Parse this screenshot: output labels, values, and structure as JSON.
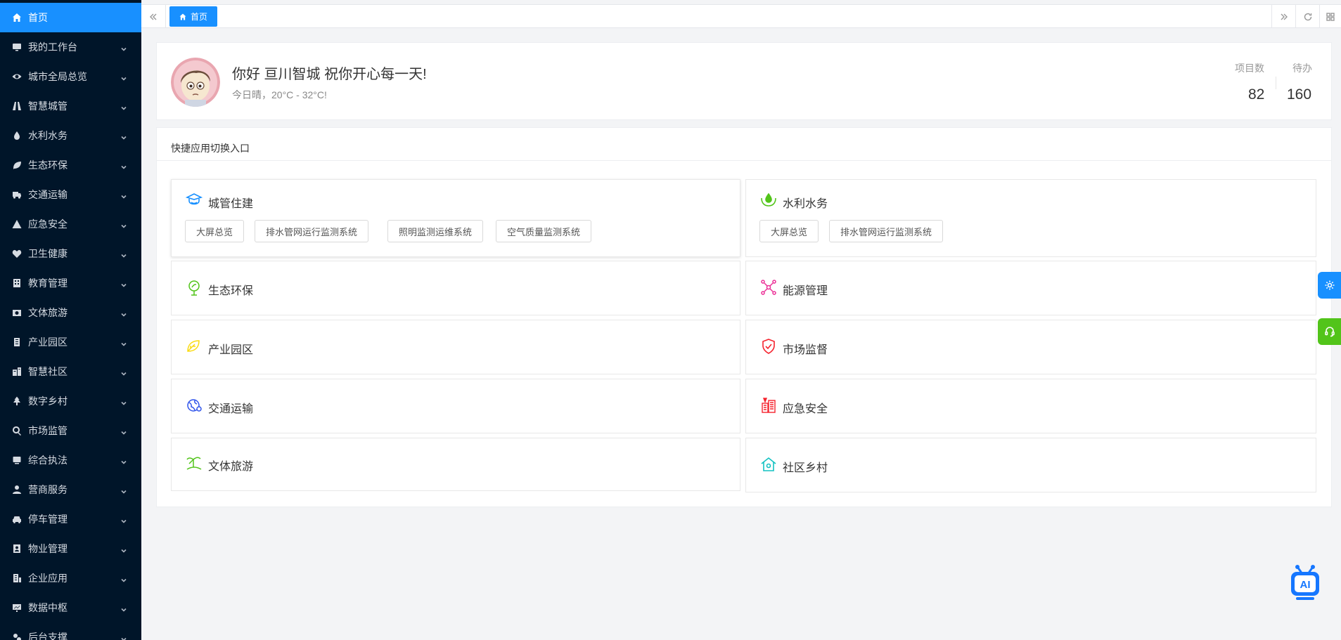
{
  "sidebar": {
    "items": [
      {
        "label": "首页",
        "icon": "home-icon",
        "active": true
      },
      {
        "label": "我的工作台",
        "icon": "monitor-icon"
      },
      {
        "label": "城市全局总览",
        "icon": "eye-icon"
      },
      {
        "label": "智慧城管",
        "icon": "road-icon"
      },
      {
        "label": "水利水务",
        "icon": "drop-icon"
      },
      {
        "label": "生态环保",
        "icon": "leaf-icon"
      },
      {
        "label": "交通运输",
        "icon": "truck-icon"
      },
      {
        "label": "应急安全",
        "icon": "warning-icon"
      },
      {
        "label": "卫生健康",
        "icon": "heartbeat-icon"
      },
      {
        "label": "教育管理",
        "icon": "school-icon"
      },
      {
        "label": "文体旅游",
        "icon": "camera-icon"
      },
      {
        "label": "产业园区",
        "icon": "building-icon"
      },
      {
        "label": "智慧社区",
        "icon": "community-icon"
      },
      {
        "label": "数字乡村",
        "icon": "tree-icon"
      },
      {
        "label": "市场监管",
        "icon": "search-icon"
      },
      {
        "label": "综合执法",
        "icon": "desktop-icon"
      },
      {
        "label": "营商服务",
        "icon": "user-icon"
      },
      {
        "label": "停车管理",
        "icon": "car-icon"
      },
      {
        "label": "物业管理",
        "icon": "contact-icon"
      },
      {
        "label": "企业应用",
        "icon": "office-icon"
      },
      {
        "label": "数据中枢",
        "icon": "presentation-icon"
      },
      {
        "label": "后台支撑",
        "icon": "cogs-icon"
      }
    ]
  },
  "tabs": {
    "items": [
      {
        "label": "首页",
        "icon": "home-icon"
      }
    ]
  },
  "welcome": {
    "greeting": "你好 亘川智城 祝你开心每一天!",
    "weather": "今日晴，20°C - 32°C!",
    "stats": [
      {
        "label": "项目数",
        "value": "82"
      },
      {
        "label": "待办",
        "value": "160"
      }
    ]
  },
  "quick": {
    "title": "快捷应用切换入口",
    "apps": [
      {
        "name": "城管住建",
        "icon": "police-cap-icon",
        "color": "#1890ff",
        "systems": [
          "大屏总览",
          "排水管网运行监测系统",
          "照明监测运维系统",
          "空气质量监测系统"
        ]
      },
      {
        "name": "水利水务",
        "icon": "water-hand-icon",
        "color": "#52c41a",
        "systems": [
          "大屏总览",
          "排水管网运行监测系统"
        ]
      },
      {
        "name": "生态环保",
        "icon": "eco-leaf-icon",
        "color": "#52c41a",
        "systems": []
      },
      {
        "name": "能源管理",
        "icon": "energy-network-icon",
        "color": "#eb2f96",
        "systems": []
      },
      {
        "name": "产业园区",
        "icon": "industry-park-icon",
        "color": "#fadb14",
        "systems": []
      },
      {
        "name": "市场监督",
        "icon": "shield-check-icon",
        "color": "#f5222d",
        "systems": []
      },
      {
        "name": "交通运输",
        "icon": "traffic-globe-icon",
        "color": "#2f54eb",
        "systems": []
      },
      {
        "name": "应急安全",
        "icon": "emergency-building-icon",
        "color": "#f5222d",
        "systems": []
      },
      {
        "name": "文体旅游",
        "icon": "island-icon",
        "color": "#52c41a",
        "systems": []
      },
      {
        "name": "社区乡村",
        "icon": "house-icon",
        "color": "#13c2c2",
        "systems": []
      }
    ]
  },
  "floating": {
    "settings_color": "#1890ff",
    "service_color": "#52c41a",
    "ai_label": "AI"
  }
}
